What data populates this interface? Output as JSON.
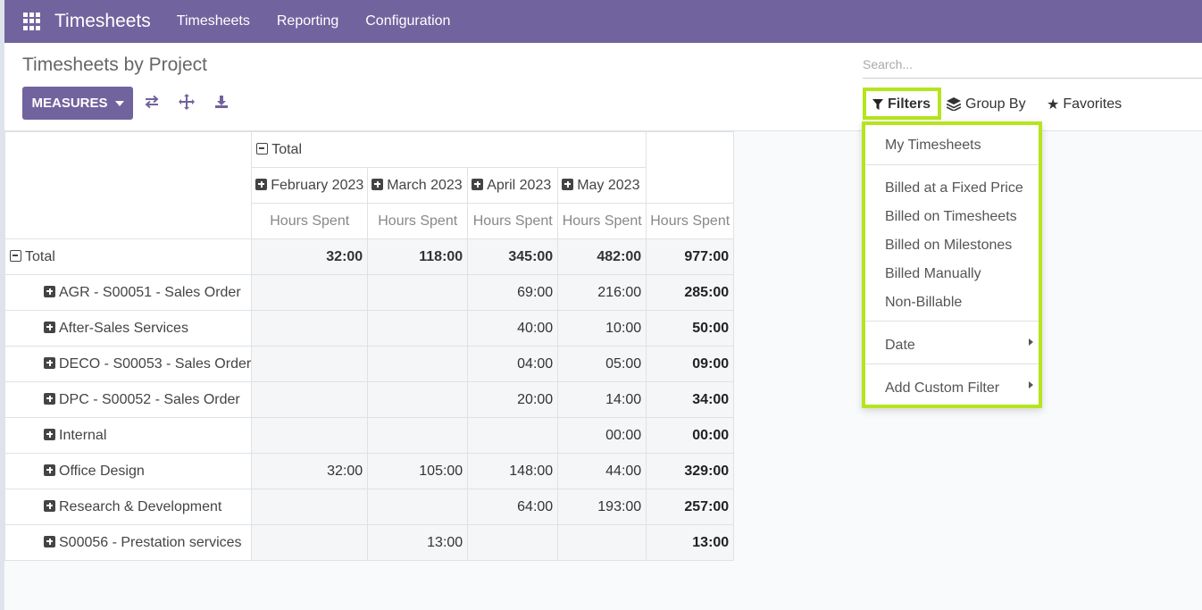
{
  "navbar": {
    "brand": "Timesheets",
    "menu": [
      "Timesheets",
      "Reporting",
      "Configuration"
    ]
  },
  "page": {
    "title": "Timesheets by Project",
    "measures_label": "MEASURES"
  },
  "search": {
    "placeholder": "Search...",
    "filters_label": "Filters",
    "groupby_label": "Group By",
    "favorites_label": "Favorites"
  },
  "filters_menu": {
    "items": [
      "My Timesheets",
      "Billed at a Fixed Price",
      "Billed on Timesheets",
      "Billed on Milestones",
      "Billed Manually",
      "Non-Billable",
      "Date",
      "Add Custom Filter"
    ]
  },
  "pivot": {
    "col_total_label": "Total",
    "months": [
      "February 2023",
      "March 2023",
      "April 2023",
      "May 2023"
    ],
    "measure": "Hours Spent",
    "row_total_label": "Total",
    "totals": [
      "32:00",
      "118:00",
      "345:00",
      "482:00",
      "977:00"
    ],
    "rows": [
      {
        "label": "AGR - S00051 - Sales Order",
        "values": [
          "",
          "",
          "69:00",
          "216:00",
          "285:00"
        ]
      },
      {
        "label": "After-Sales Services",
        "values": [
          "",
          "",
          "40:00",
          "10:00",
          "50:00"
        ]
      },
      {
        "label": "DECO - S00053 - Sales Order",
        "values": [
          "",
          "",
          "04:00",
          "05:00",
          "09:00"
        ]
      },
      {
        "label": "DPC - S00052 - Sales Order",
        "values": [
          "",
          "",
          "20:00",
          "14:00",
          "34:00"
        ]
      },
      {
        "label": "Internal",
        "values": [
          "",
          "",
          "",
          "00:00",
          "00:00"
        ]
      },
      {
        "label": "Office Design",
        "values": [
          "32:00",
          "105:00",
          "148:00",
          "44:00",
          "329:00"
        ]
      },
      {
        "label": "Research & Development",
        "values": [
          "",
          "",
          "64:00",
          "193:00",
          "257:00"
        ]
      },
      {
        "label": "S00056 - Prestation services",
        "values": [
          "",
          "13:00",
          "",
          "",
          "13:00"
        ]
      }
    ]
  },
  "colors": {
    "brand": "#71639e",
    "highlight": "#b5e51d"
  }
}
